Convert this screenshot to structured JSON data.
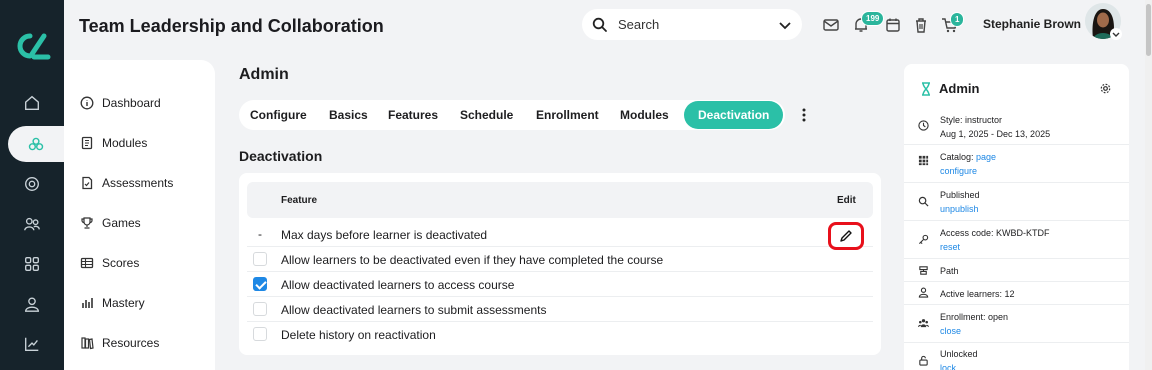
{
  "header": {
    "title": "Team Leadership and Collaboration",
    "search_placeholder": "Search",
    "notifications_count": "199",
    "cart_count": "1",
    "user_name": "Stephanie Brown"
  },
  "rail": {
    "items": [
      "home-icon",
      "courses-icon",
      "target-icon",
      "users-icon",
      "grid-icon",
      "person-icon",
      "chart-icon"
    ],
    "active": "courses-icon"
  },
  "sidebar": {
    "items": [
      {
        "label": "Dashboard",
        "icon": "info-icon"
      },
      {
        "label": "Modules",
        "icon": "book-icon"
      },
      {
        "label": "Assessments",
        "icon": "doc-check-icon"
      },
      {
        "label": "Games",
        "icon": "trophy-icon"
      },
      {
        "label": "Scores",
        "icon": "table-icon"
      },
      {
        "label": "Mastery",
        "icon": "bar-chart-icon"
      },
      {
        "label": "Resources",
        "icon": "books-icon"
      }
    ]
  },
  "main": {
    "heading": "Admin",
    "tabs": [
      "Configure",
      "Basics",
      "Features",
      "Schedule",
      "Enrollment",
      "Modules",
      "Deactivation"
    ],
    "active_tab": "Deactivation",
    "section_title": "Deactivation",
    "table": {
      "col_feature": "Feature",
      "col_edit": "Edit",
      "rows": [
        {
          "label": "Max days before learner is deactivated",
          "type": "dash",
          "marker": "-"
        },
        {
          "label": "Allow learners to be deactivated even if they have completed the course",
          "type": "checkbox",
          "checked": false
        },
        {
          "label": "Allow deactivated learners to access course",
          "type": "checkbox",
          "checked": true
        },
        {
          "label": "Allow deactivated learners to submit assessments",
          "type": "checkbox",
          "checked": false
        },
        {
          "label": "Delete history on reactivation",
          "type": "checkbox",
          "checked": false
        }
      ]
    }
  },
  "panel": {
    "title": "Admin",
    "items": [
      {
        "icon": "clock-icon",
        "line1": "Style: instructor",
        "line2": "Aug 1, 2025 - Dec 13, 2025"
      },
      {
        "icon": "grid-icon",
        "line1": "Catalog: ",
        "line1_link": "page",
        "link": "configure"
      },
      {
        "icon": "search-icon",
        "line1": "Published",
        "link": "unpublish"
      },
      {
        "icon": "key-icon",
        "line1": "Access code: KWBD-KTDF",
        "link": "reset"
      },
      {
        "icon": "path-icon",
        "line1": "Path"
      },
      {
        "icon": "person-icon",
        "line1": "Active learners: 12"
      },
      {
        "icon": "group-icon",
        "line1": "Enrollment: open",
        "link": "close"
      },
      {
        "icon": "lock-icon",
        "line1": "Unlocked",
        "link": "lock"
      }
    ]
  },
  "colors": {
    "rail_bg": "#16232b",
    "accent": "#2bc0a7",
    "link": "#1e88e5",
    "highlight": "#e8101b"
  }
}
